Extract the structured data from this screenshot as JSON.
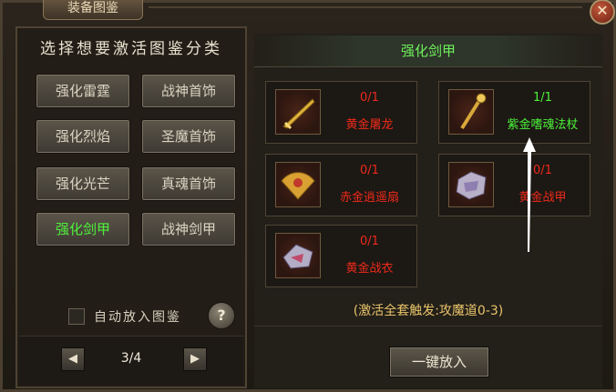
{
  "window": {
    "title": "装备图鉴",
    "close_label": "✕"
  },
  "left": {
    "heading": "选择想要激活图鉴分类",
    "categories": [
      {
        "label": "强化雷霆",
        "active": false
      },
      {
        "label": "战神首饰",
        "active": false
      },
      {
        "label": "强化烈焰",
        "active": false
      },
      {
        "label": "圣魔首饰",
        "active": false
      },
      {
        "label": "强化光芒",
        "active": false
      },
      {
        "label": "真魂首饰",
        "active": false
      },
      {
        "label": "强化剑甲",
        "active": true
      },
      {
        "label": "战神剑甲",
        "active": false
      }
    ],
    "auto_checkbox_label": "自动放入图鉴",
    "help_label": "?",
    "pager": {
      "prev_icon": "triangle-left-icon",
      "next_icon": "triangle-right-icon",
      "page_text": "3/4"
    }
  },
  "right": {
    "title": "强化剑甲",
    "items": [
      {
        "count": "0/1",
        "name": "黄金屠龙",
        "status": "locked",
        "icon": "golden-sword-icon"
      },
      {
        "count": "1/1",
        "name": "紫金嗜魂法杖",
        "status": "activated",
        "icon": "golden-staff-icon"
      },
      {
        "count": "0/1",
        "name": "赤金逍遥扇",
        "status": "locked",
        "icon": "golden-fan-icon"
      },
      {
        "count": "0/1",
        "name": "黄金战甲",
        "status": "locked",
        "icon": "crystal-armor-icon"
      },
      {
        "count": "0/1",
        "name": "黄金战衣",
        "status": "locked",
        "icon": "crystal-robe-icon"
      }
    ],
    "set_bonus": "(激活全套触发:攻魔道0-3)",
    "put_all_label": "一键放入"
  },
  "colors": {
    "locked": "#ee2a1a",
    "activated": "#4ef23a",
    "bonus": "#e8c46a"
  }
}
